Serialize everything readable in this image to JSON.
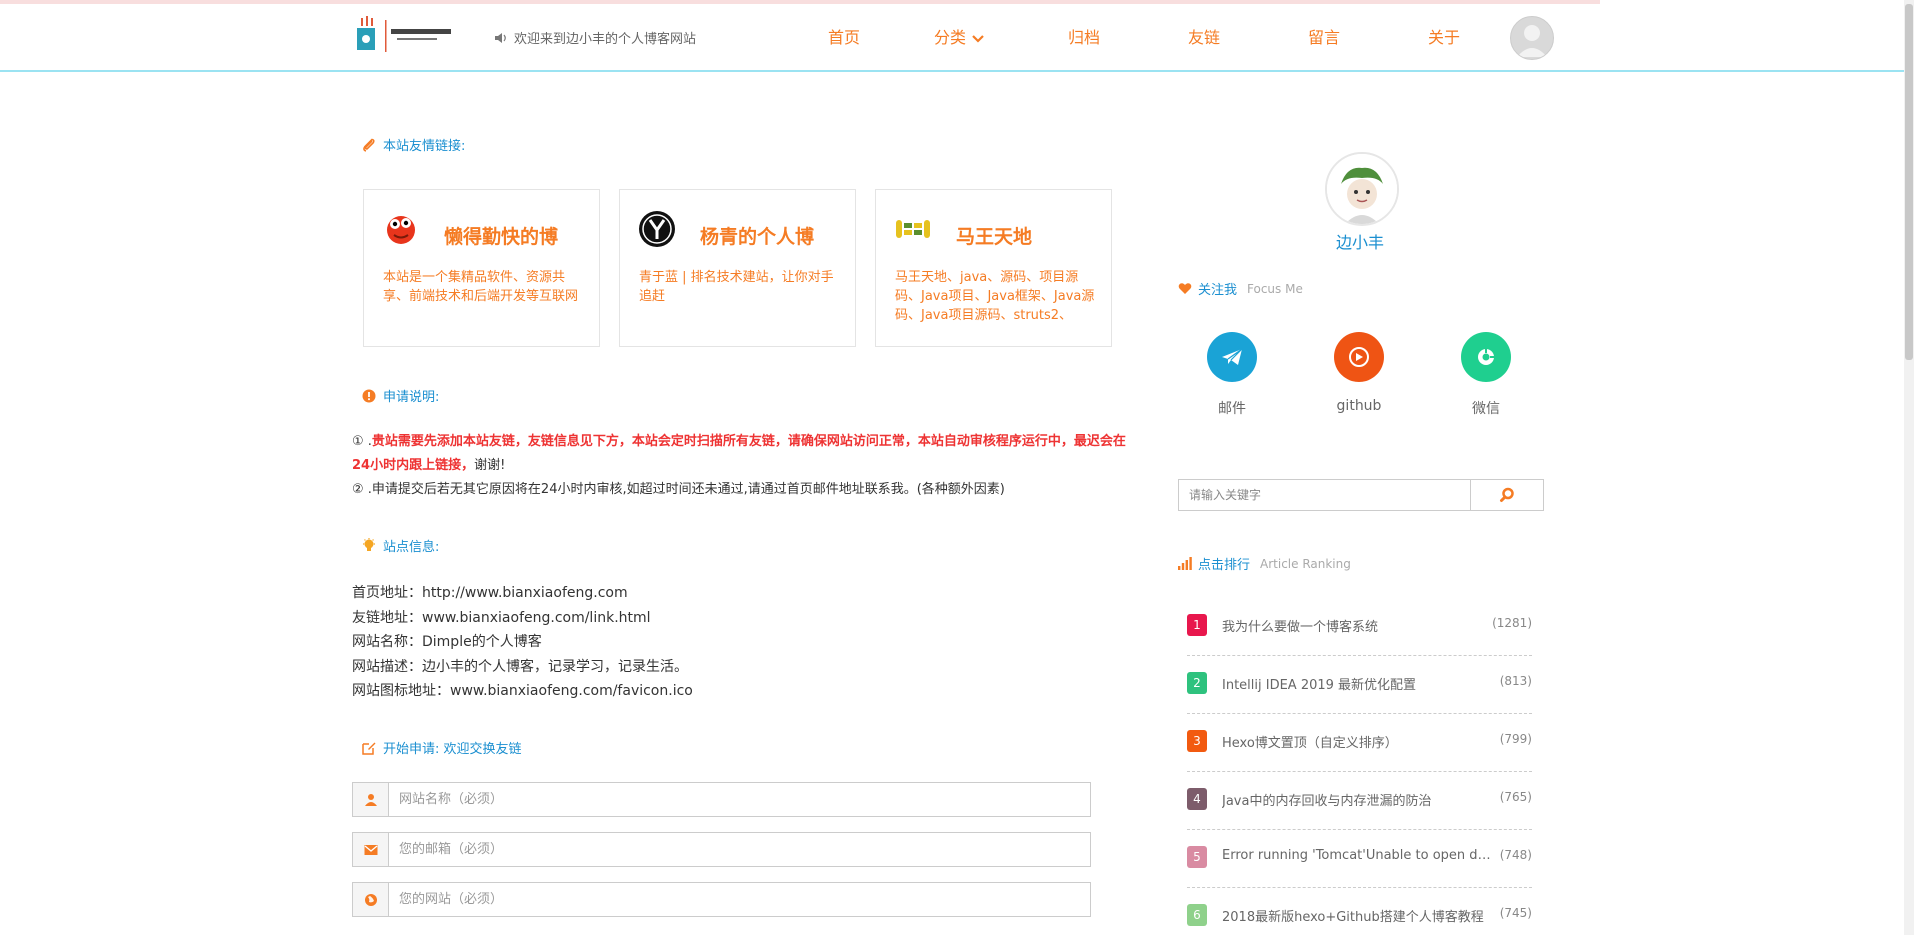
{
  "header": {
    "notice": "欢迎来到边小丰的个人博客网站",
    "nav": [
      {
        "label": "首页"
      },
      {
        "label": "分类"
      },
      {
        "label": "归档"
      },
      {
        "label": "友链"
      },
      {
        "label": "留言"
      },
      {
        "label": "关于"
      }
    ],
    "accent_color": "#f57c24"
  },
  "friends": {
    "title": "本站友情链接:",
    "cards": [
      {
        "name": "懒得勤快的博",
        "desc": "本站是一个集精品软件、资源共享、前端技术和后端开发等互联网",
        "icon": "red-cartoon-icon"
      },
      {
        "name": "杨青的个人博",
        "desc": "青于蓝 | 排名技术建站，让你对手追赶",
        "icon": "y-logo-icon"
      },
      {
        "name": "马王天地",
        "desc": "马王天地、java、源码、项目源码、Java项目、Java框架、Java源码、Java项目源码、struts2、",
        "icon": "mawang-logo-icon"
      }
    ]
  },
  "apply_notes": {
    "title": "申请说明:",
    "line1_prefix": "① .",
    "line1_red": "贵站需要先添加本站友链，友链信息见下方，本站会定时扫描所有友链，请确保网站访问正常，本站自动审核程序运行中，最迟会在24小时内跟上链接，",
    "line1_suffix": "谢谢!",
    "line2": "② .申请提交后若无其它原因将在24小时内审核,如超过时间还未通过,请通过首页邮件地址联系我。(各种额外因素)"
  },
  "site_info": {
    "title": "站点信息:",
    "lines": [
      "首页地址：http://www.bianxiaofeng.com",
      "友链地址：www.bianxiaofeng.com/link.html",
      "网站名称：Dimple的个人博客",
      "网站描述：边小丰的个人博客，记录学习，记录生活。",
      "网站图标地址：www.bianxiaofeng.com/favicon.ico"
    ]
  },
  "apply_form": {
    "title": "开始申请: 欢迎交换友链",
    "name_placeholder": "网站名称（必须）",
    "email_placeholder": "您的邮箱（必须）",
    "site_placeholder": "您的网站（必须）"
  },
  "profile": {
    "name": "边小丰",
    "follow_title": "关注我",
    "follow_en": "Focus Me",
    "social": [
      {
        "label": "邮件",
        "color": "#1aa3d6"
      },
      {
        "label": "github",
        "color": "#ef5414"
      },
      {
        "label": "微信",
        "color": "#1fcf8f"
      }
    ]
  },
  "search": {
    "placeholder": "请输入关键字"
  },
  "ranking": {
    "title": "点击排行",
    "title_en": "Article Ranking",
    "items": [
      {
        "num": "1",
        "title": "我为什么要做一个博客系统",
        "count": "(1281)",
        "color": "#e8174d"
      },
      {
        "num": "2",
        "title": "Intellij IDEA 2019 最新优化配置",
        "count": "(813)",
        "color": "#2ec27e"
      },
      {
        "num": "3",
        "title": "Hexo博文置顶（自定义排序）",
        "count": "(799)",
        "color": "#f25a10"
      },
      {
        "num": "4",
        "title": "Java中的内存回收与内存泄漏的防治",
        "count": "(765)",
        "color": "#7d5c6b"
      },
      {
        "num": "5",
        "title": "Error running 'Tomcat'Unable to open debugger port",
        "count": "(748)",
        "color": "#d98ba2"
      },
      {
        "num": "6",
        "title": "2018最新版hexo+Github搭建个人博客教程",
        "count": "(745)",
        "color": "#8fd18b"
      }
    ]
  }
}
